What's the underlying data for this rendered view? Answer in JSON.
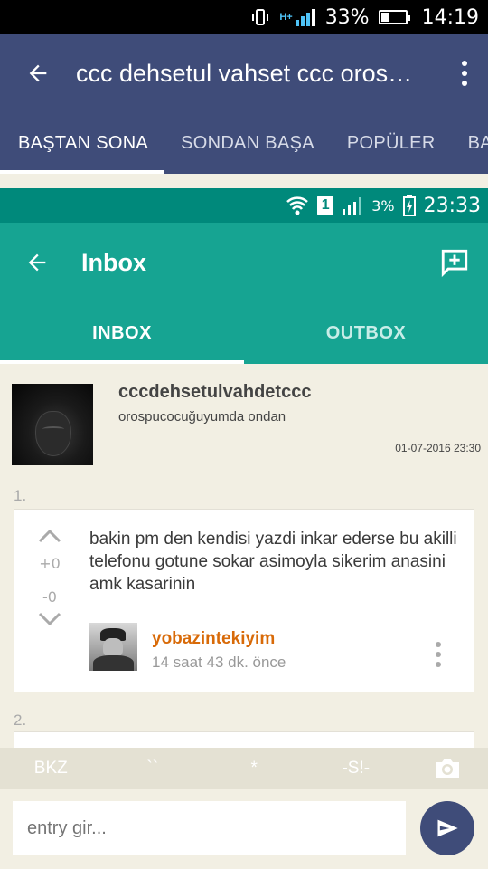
{
  "status_bar": {
    "battery": "33%",
    "time": "14:19",
    "network": "H+",
    "battery_level": 0.33
  },
  "app_bar": {
    "title": "ccc dehsetul vahset ccc orospucocuğuyumda ondan"
  },
  "top_tabs": [
    {
      "label": "BAŞTAN SONA",
      "active": true
    },
    {
      "label": "SONDAN BAŞA",
      "active": false
    },
    {
      "label": "POPÜLER",
      "active": false
    },
    {
      "label": "BAŞ",
      "active": false
    }
  ],
  "inner_status": {
    "sim": "1",
    "battery": "3%",
    "time": "23:33"
  },
  "inner_app_bar": {
    "title": "Inbox"
  },
  "inner_tabs": [
    {
      "label": "INBOX",
      "active": true
    },
    {
      "label": "OUTBOX",
      "active": false
    }
  ],
  "entry_header": {
    "username": "cccdehsetulvahdetccc",
    "subtitle": "orospucocuğuyumda ondan",
    "date": "01-07-2016 23:30"
  },
  "entries": [
    {
      "index": "1.",
      "upvotes": "+0",
      "downvotes": "-0",
      "text": "bakin pm den kendisi yazdi inkar ederse bu akilli telefonu gotune sokar asimoyla sikerim anasini amk kasarinin",
      "author": "yobazintekiyim",
      "time": "14 saat 43 dk. önce"
    },
    {
      "index": "2."
    }
  ],
  "toolbar": {
    "bkz": "BKZ",
    "backticks": "``",
    "star": "*",
    "spoiler": "-S!-"
  },
  "composer": {
    "placeholder": "entry gir..."
  },
  "colors": {
    "primary": "#3f4c79",
    "inbox_teal": "#16a492",
    "author": "#d86a08",
    "background": "#f2efe3"
  }
}
